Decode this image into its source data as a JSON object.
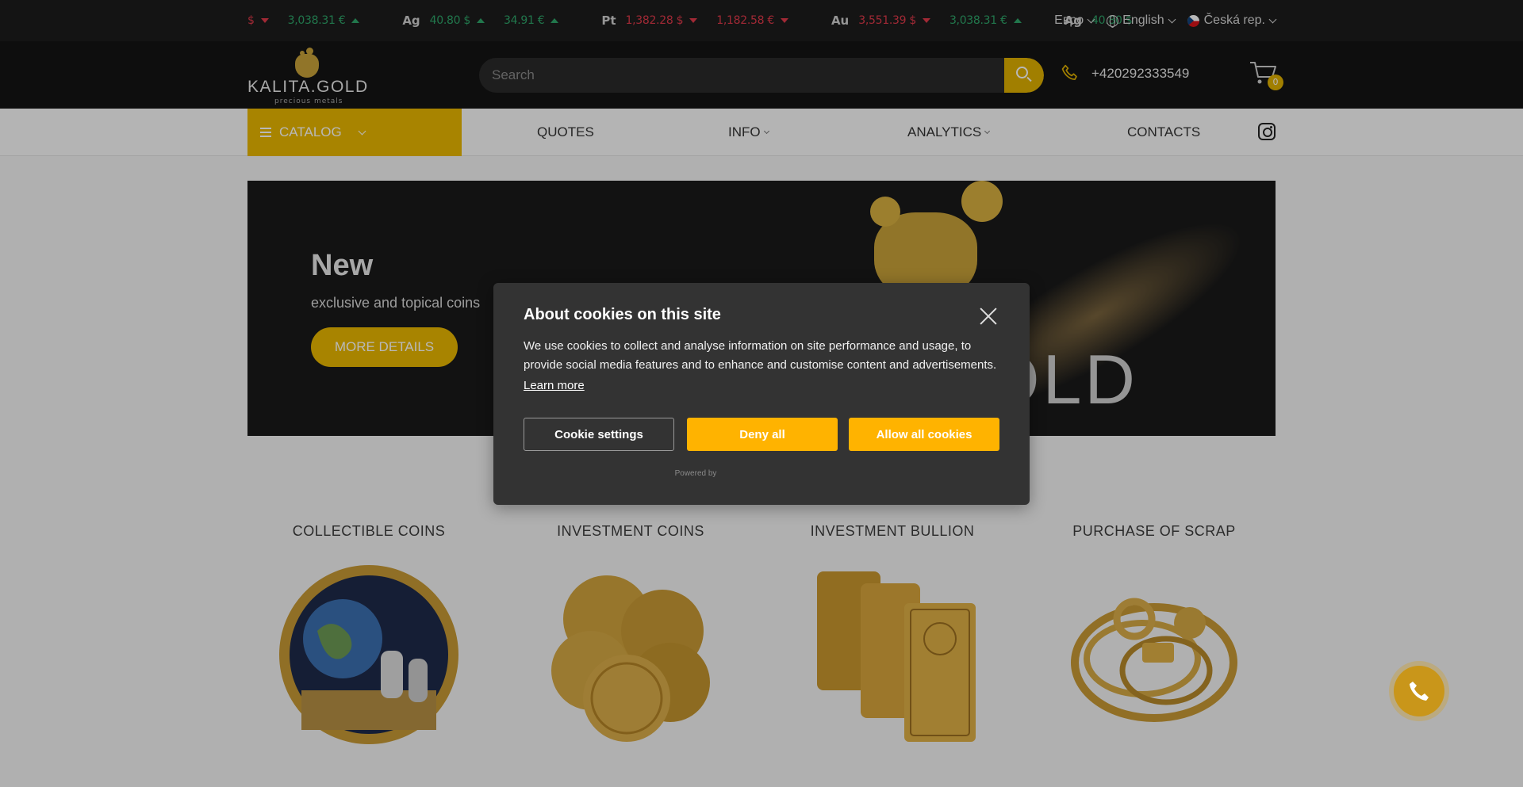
{
  "ticker": {
    "items": [
      {
        "metal": "",
        "v1": "$",
        "v1_dir": "down",
        "v2": "3,038.31 €",
        "v2_dir": "up"
      },
      {
        "metal": "Ag",
        "v1": "40.80 $",
        "v1_dir": "up",
        "v2": "34.91 €",
        "v2_dir": "up"
      },
      {
        "metal": "Pt",
        "v1": "1,382.28 $",
        "v1_dir": "down",
        "v2": "1,182.58 €",
        "v2_dir": "down"
      },
      {
        "metal": "Au",
        "v1": "3,551.39 $",
        "v1_dir": "down",
        "v2": "3,038.31 €",
        "v2_dir": "up"
      },
      {
        "metal": "Ag",
        "v1": "40.80 $",
        "v1_dir": "up",
        "v2": "",
        "v2_dir": ""
      }
    ],
    "currency": "Евро",
    "language": "English",
    "country": "Česká rep."
  },
  "header": {
    "logo_name": "KALITA.GOLD",
    "logo_tagline": "precious metals",
    "search_placeholder": "Search",
    "phone": "+420292333549",
    "cart_count": "0"
  },
  "nav": {
    "catalog": "CATALOG",
    "quotes": "QUOTES",
    "info": "INFO",
    "analytics": "ANALYTICS",
    "contacts": "CONTACTS"
  },
  "banner": {
    "title": "New",
    "subtitle": "exclusive and topical coins",
    "button": "MORE DETAILS",
    "background_text": "OLD"
  },
  "categories": [
    {
      "title": "COLLECTIBLE COINS"
    },
    {
      "title": "INVESTMENT COINS"
    },
    {
      "title": "INVESTMENT BULLION"
    },
    {
      "title": "PURCHASE OF SCRAP"
    }
  ],
  "cookie": {
    "title": "About cookies on this site",
    "description": "We use cookies to collect and analyse information on site performance and usage, to provide social media features and to enhance and customise content and advertisements.",
    "learn_more": "Learn more",
    "settings": "Cookie settings",
    "deny": "Deny all",
    "allow": "Allow all cookies",
    "powered": "Powered by"
  },
  "colors": {
    "accent": "#e9b800",
    "cookie_button": "#ffb300",
    "up": "#2fa66a",
    "down": "#e0394a"
  }
}
